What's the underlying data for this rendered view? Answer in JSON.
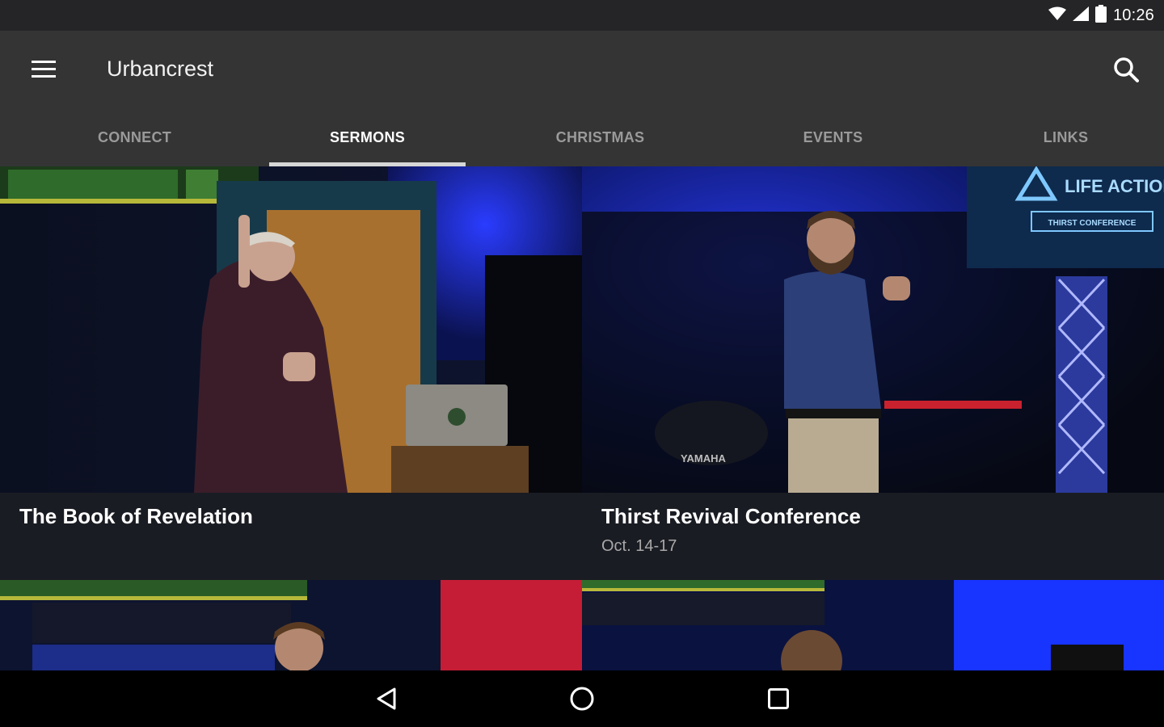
{
  "status_bar": {
    "time": "10:26",
    "icons": [
      "wifi-icon",
      "cell-signal-icon",
      "battery-icon"
    ]
  },
  "app_bar": {
    "title": "Urbancrest",
    "menu_icon": "hamburger-menu-icon",
    "search_icon": "search-icon"
  },
  "tabs": [
    {
      "label": "CONNECT",
      "active": false
    },
    {
      "label": "SERMONS",
      "active": true
    },
    {
      "label": "CHRISTMAS",
      "active": false
    },
    {
      "label": "EVENTS",
      "active": false
    },
    {
      "label": "LINKS",
      "active": false
    }
  ],
  "cards": [
    {
      "title": "The Book of Revelation",
      "subtitle": ""
    },
    {
      "title": "Thirst Revival Conference",
      "subtitle": "Oct. 14-17"
    }
  ],
  "stage_graphics": {
    "logo_text": "LIFE ACTION",
    "banner_text": "THIRST CONFERENCE",
    "drum_brand": "YAMAHA"
  },
  "nav_bar": {
    "icons": [
      "back-icon",
      "home-icon",
      "recents-icon"
    ]
  },
  "colors": {
    "status_bar": "#252527",
    "app_bar": "#343434",
    "background": "#16181d",
    "tab_indicator": "#d6d6d6",
    "stage_blue": "#1b2fd6",
    "stage_red": "#d21f3c"
  }
}
